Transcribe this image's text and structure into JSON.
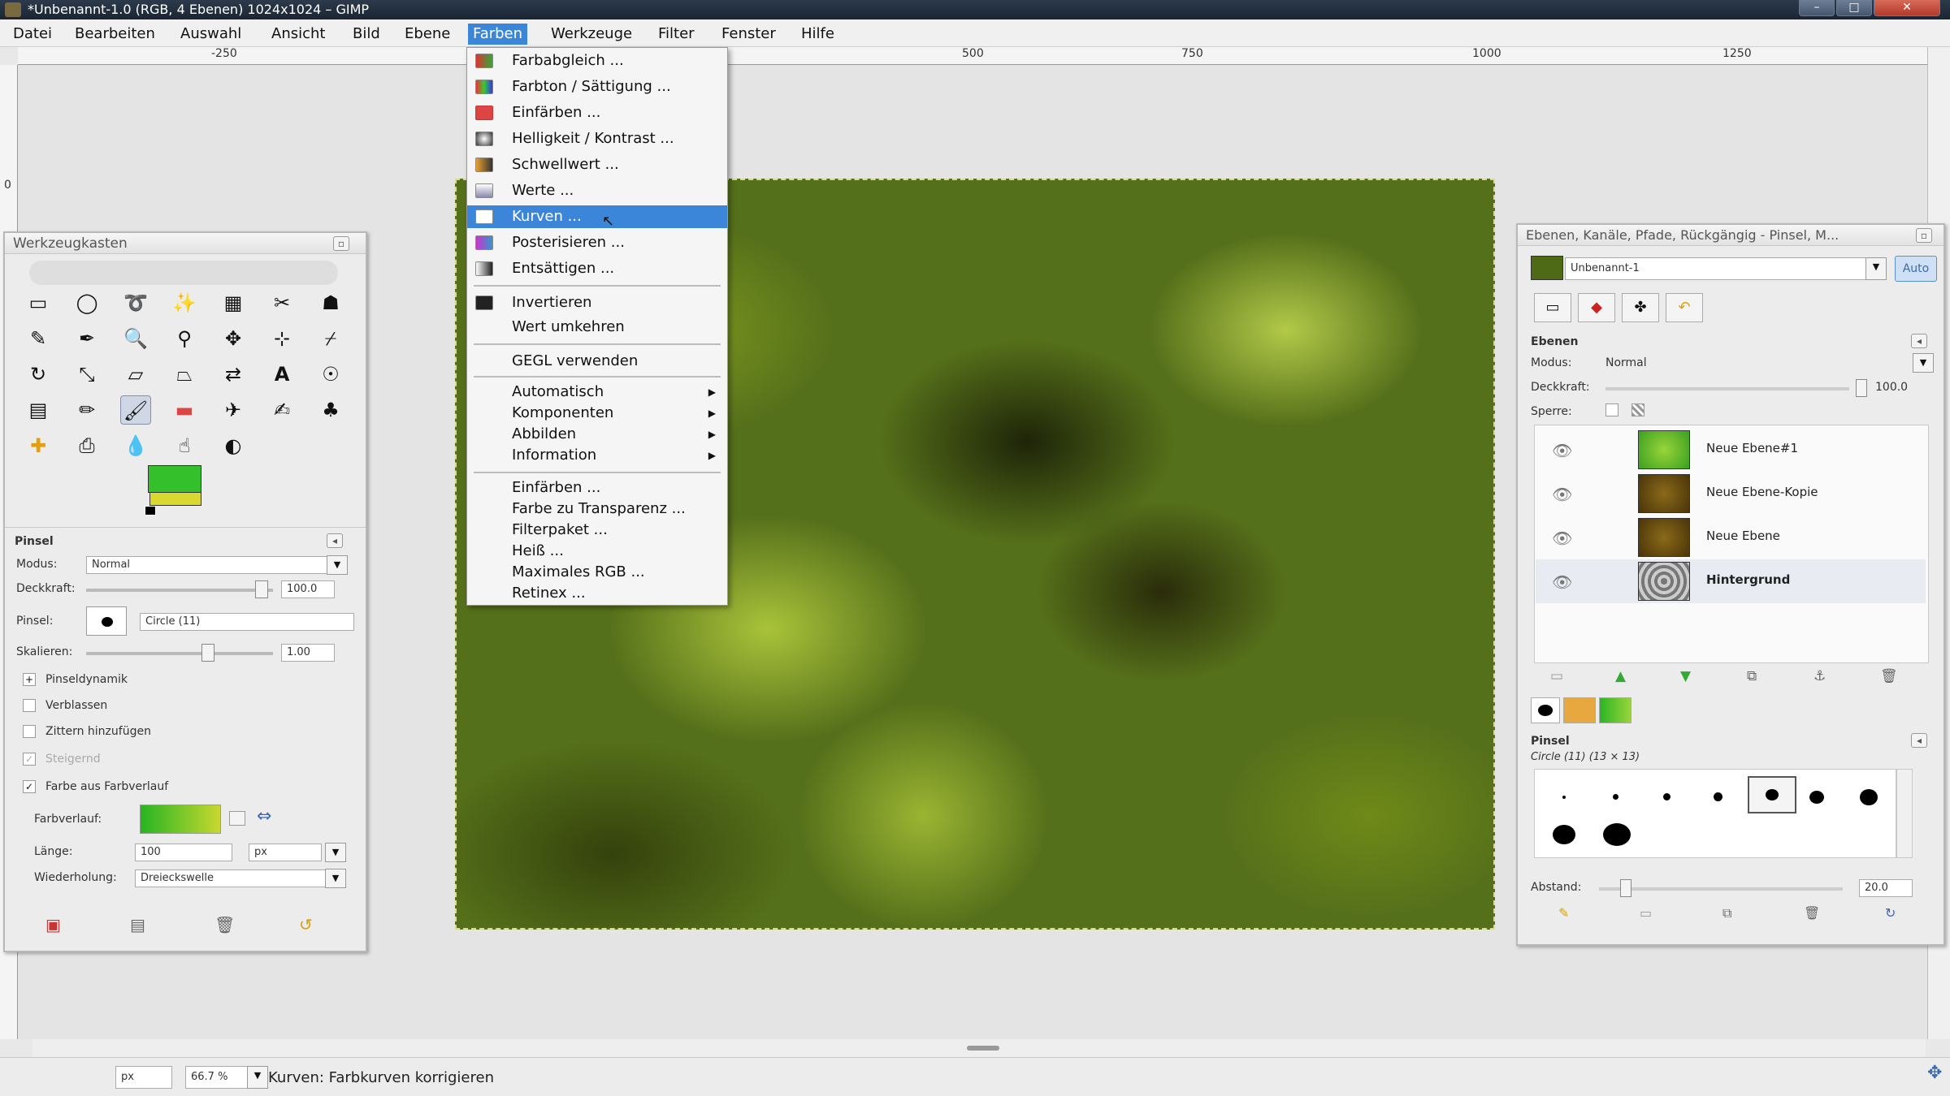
{
  "window": {
    "title": "*Unbenannt-1.0 (RGB, 4 Ebenen) 1024x1024 – GIMP"
  },
  "menubar": {
    "items": [
      "Datei",
      "Bearbeiten",
      "Auswahl",
      "Ansicht",
      "Bild",
      "Ebene",
      "Farben",
      "Werkzeuge",
      "Filter",
      "Fenster",
      "Hilfe"
    ],
    "active": "Farben"
  },
  "ruler": {
    "top_labels": [
      "-250",
      "500",
      "750",
      "1000",
      "1250"
    ],
    "left_labels": [
      "0"
    ]
  },
  "farben_menu": {
    "items": [
      "Farbabgleich ...",
      "Farbton / Sättigung ...",
      "Einfärben ...",
      "Helligkeit / Kontrast ...",
      "Schwellwert ...",
      "Werte ...",
      "Kurven ...",
      "Posterisieren ...",
      "Entsättigen ..."
    ],
    "group2": [
      "Invertieren",
      "Wert umkehren"
    ],
    "group3": [
      "GEGL verwenden"
    ],
    "submenus": [
      "Automatisch",
      "Komponenten",
      "Abbilden",
      "Information"
    ],
    "group5": [
      "Einfärben ...",
      "Farbe zu Transparenz ...",
      "Filterpaket ...",
      "Heiß ...",
      "Maximales RGB ...",
      "Retinex ..."
    ],
    "highlighted": "Kurven ..."
  },
  "toolbox": {
    "title": "Werkzeugkasten",
    "options_title": "Pinsel",
    "modus_label": "Modus:",
    "modus_value": "Normal",
    "deckkraft_label": "Deckkraft:",
    "deckkraft_value": "100.0",
    "pinsel_label": "Pinsel:",
    "pinsel_value": "Circle (11)",
    "skalieren_label": "Skalieren:",
    "skalieren_value": "1.00",
    "checkboxes": [
      "Pinseldynamik",
      "Verblassen",
      "Zittern hinzufügen",
      "Steigernd",
      "Farbe aus Farbverlauf"
    ],
    "farbverlauf_label": "Farbverlauf:",
    "laenge_label": "Länge:",
    "laenge_value": "100",
    "laenge_unit": "px",
    "wiederholung_label": "Wiederholung:",
    "wiederholung_value": "Dreieckswelle"
  },
  "dock": {
    "title": "Ebenen, Kanäle, Pfade, Rückgängig - Pinsel, M...",
    "image_name": "Unbenannt-1",
    "auto_label": "Auto",
    "layers_title": "Ebenen",
    "modus_label": "Modus:",
    "modus_value": "Normal",
    "deckkraft_label": "Deckkraft:",
    "deckkraft_value": "100.0",
    "sperre_label": "Sperre:",
    "layers": [
      "Neue Ebene#1",
      "Neue Ebene-Kopie",
      "Neue Ebene",
      "Hintergrund"
    ],
    "brushes_title": "Pinsel",
    "brush_name": "Circle (11) (13 × 13)",
    "abstand_label": "Abstand:",
    "abstand_value": "20.0"
  },
  "status": {
    "unit": "px",
    "zoom": "66.7 %",
    "message": "Kurven: Farbkurven korrigieren"
  }
}
